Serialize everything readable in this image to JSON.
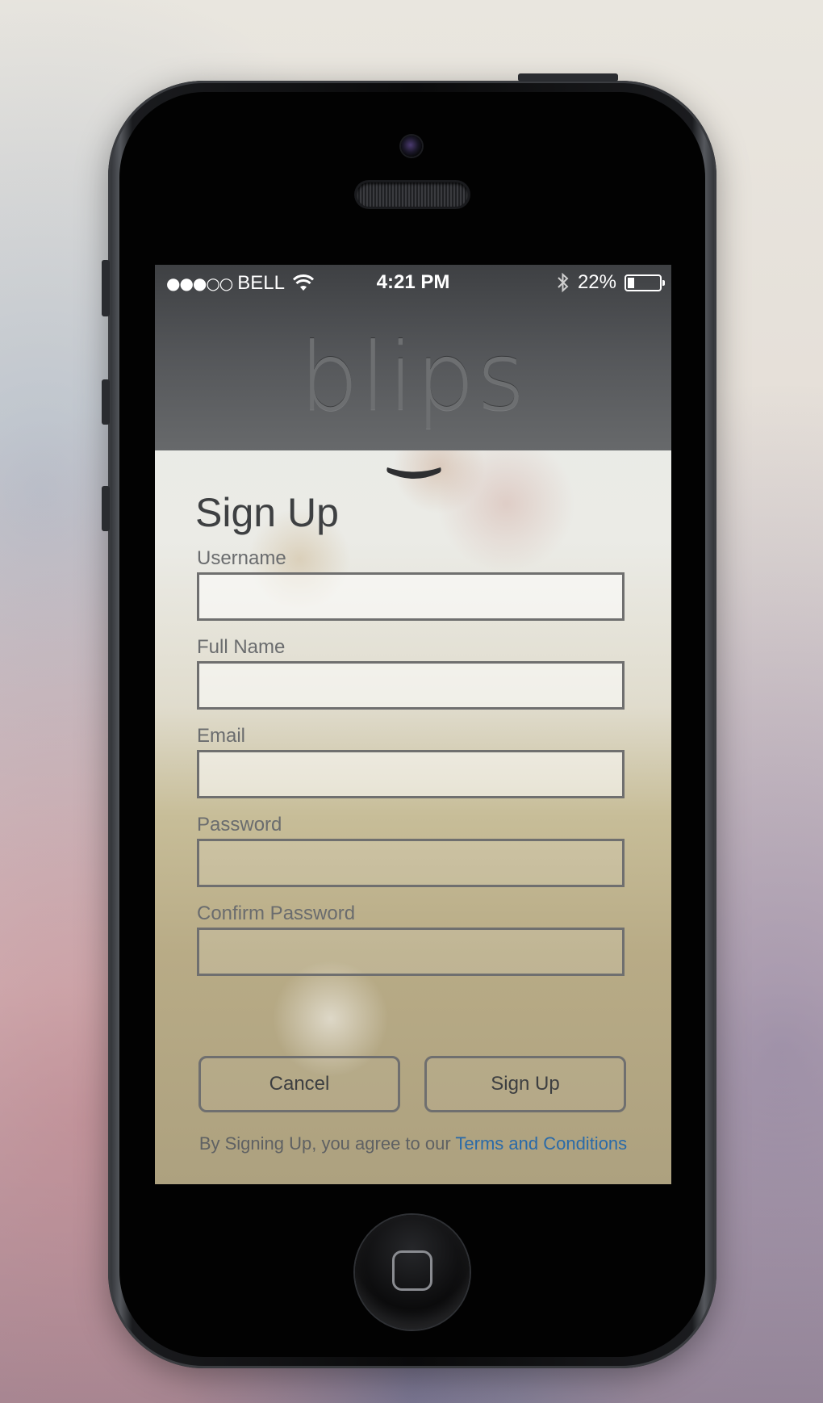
{
  "status_bar": {
    "signal": "●●●○○",
    "carrier": "BELL",
    "time": "4:21 PM",
    "battery_percent": "22%",
    "battery_level": 0.22
  },
  "app": {
    "logo": "blips"
  },
  "form": {
    "title": "Sign Up",
    "fields": [
      {
        "label": "Username",
        "value": ""
      },
      {
        "label": "Full Name",
        "value": ""
      },
      {
        "label": "Email",
        "value": ""
      },
      {
        "label": "Password",
        "value": ""
      },
      {
        "label": "Confirm Password",
        "value": ""
      }
    ],
    "cancel_label": "Cancel",
    "submit_label": "Sign Up",
    "terms_prefix": "By Signing Up, you agree to our ",
    "terms_link": "Terms and Conditions"
  },
  "icons": {
    "wifi": "wifi-icon",
    "bluetooth": "bluetooth-icon",
    "battery": "battery-icon",
    "collapse": "chevron-down-icon",
    "home": "home-button-icon"
  },
  "colors": {
    "link": "#2a6aa8",
    "header": "#55575a",
    "text": "#3e4042"
  }
}
